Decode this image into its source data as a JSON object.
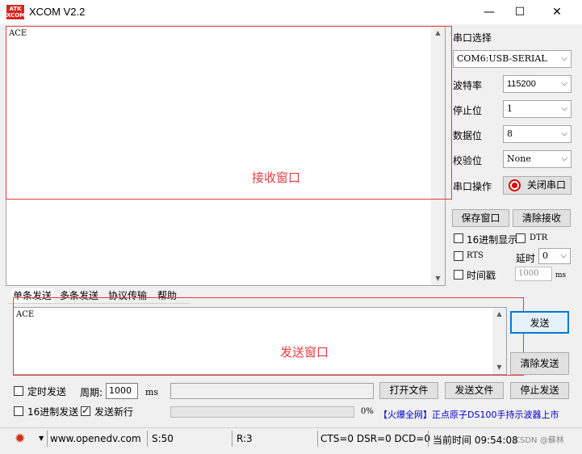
{
  "window": {
    "logo_text": "ATK\nXCOM",
    "title": "XCOM V2.2",
    "minimize": "—",
    "maximize": "☐",
    "close": "✕"
  },
  "receive": {
    "content": "ACE",
    "annotation": "接收窗口"
  },
  "port": {
    "section_label": "串口选择",
    "port_value": "COM6:USB-SERIAL",
    "baud_label": "波特率",
    "baud_value": "115200",
    "stop_label": "停止位",
    "stop_value": "1",
    "data_label": "数据位",
    "data_value": "8",
    "parity_label": "校验位",
    "parity_value": "None",
    "op_label": "串口操作",
    "close_port_label": "关闭串口",
    "status_color": "#e00000"
  },
  "controls": {
    "save_window": "保存窗口",
    "clear_receive": "清除接收",
    "hex_display": "16进制显示",
    "dtr": "DTR",
    "rts": "RTS",
    "delay_label": "延时",
    "delay_value": "0",
    "timestamp": "时间戳",
    "timestamp_value": "1000",
    "ms": "ms"
  },
  "tabs": [
    "单条发送",
    "多条发送",
    "协议传输",
    "帮助"
  ],
  "send": {
    "content": "ACE",
    "annotation": "发送窗口",
    "send_button": "发送",
    "clear_send": "清除发送"
  },
  "bottom": {
    "timed_send": "定时发送",
    "period_label": "周期:",
    "period_value": "1000",
    "ms": "ms",
    "open_file": "打开文件",
    "send_file": "发送文件",
    "stop_send": "停止发送",
    "hex_send": "16进制发送",
    "send_newline": "发送新行",
    "progress_text": "0%",
    "progress": 0,
    "ad_text": "【火爆全网】正点原子DS100手持示波器上市"
  },
  "status": {
    "url": "www.openedv.com",
    "sent": "S:50",
    "received": "R:3",
    "lines": "CTS=0 DSR=0 DCD=0",
    "time": "当前时间 09:54:08",
    "watermark": "CSDN @蘇林"
  }
}
